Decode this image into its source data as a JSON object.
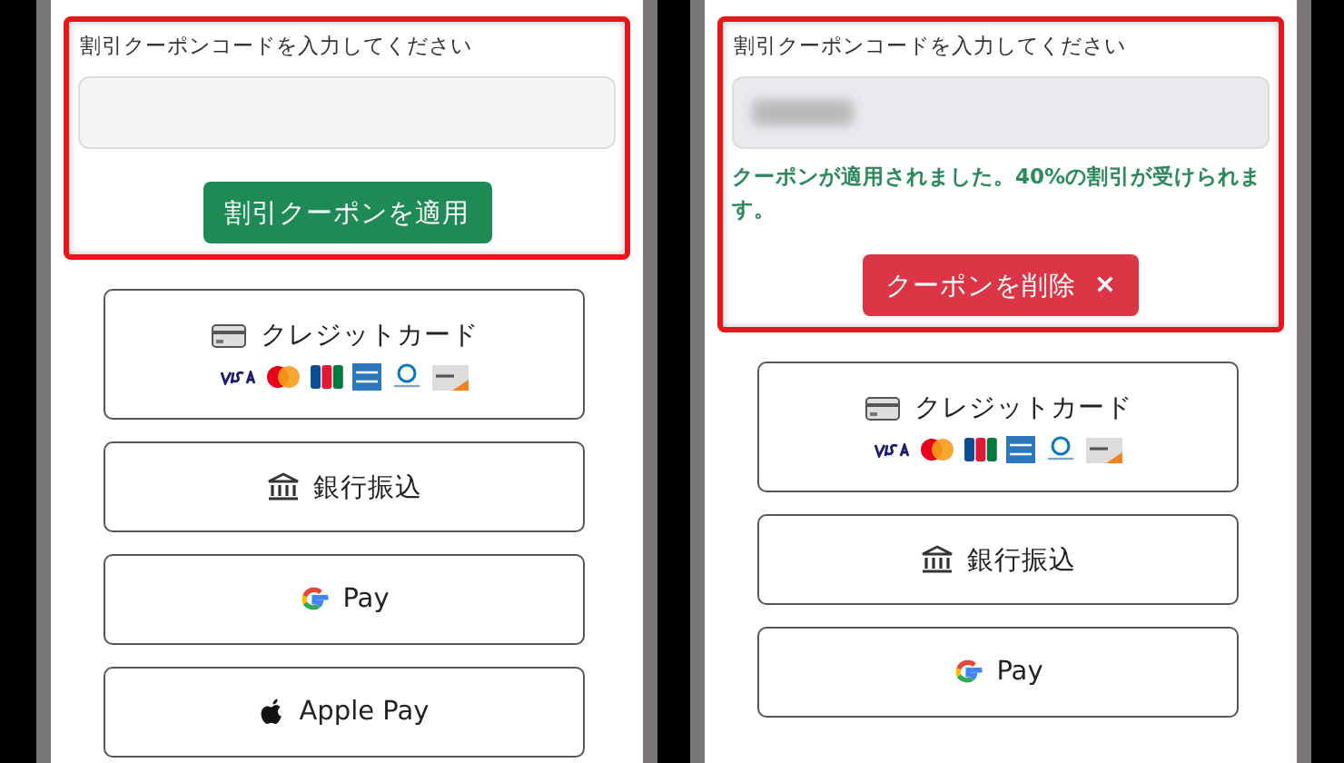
{
  "screens": [
    {
      "coupon": {
        "label": "割引クーポンコードを入力してください",
        "input": {
          "filled": false
        },
        "button": {
          "kind": "apply",
          "label": "割引クーポンを適用"
        }
      },
      "methods": [
        {
          "kind": "card",
          "label": "クレジットカード"
        },
        {
          "kind": "bank",
          "label": "銀行振込"
        },
        {
          "kind": "gpay",
          "label": "Pay"
        },
        {
          "kind": "apple",
          "label": "Apple Pay"
        }
      ]
    },
    {
      "coupon": {
        "label": "割引クーポンコードを入力してください",
        "input": {
          "filled": true
        },
        "message": "クーポンが適用されました。40%の割引が受けられます。",
        "button": {
          "kind": "remove",
          "label": "クーポンを削除",
          "icon": "×"
        }
      },
      "methods": [
        {
          "kind": "card",
          "label": "クレジットカード"
        },
        {
          "kind": "bank",
          "label": "銀行振込"
        },
        {
          "kind": "gpay",
          "label": "Pay"
        }
      ]
    }
  ]
}
